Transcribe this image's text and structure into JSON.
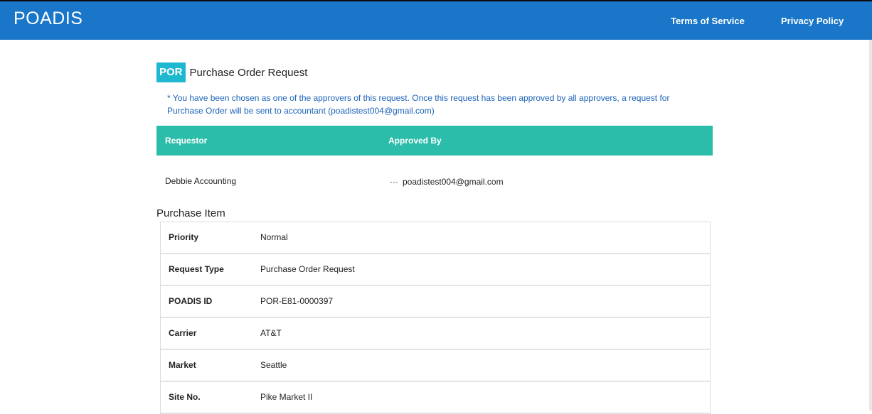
{
  "header": {
    "logo": "POADIS",
    "links": [
      "Terms of Service",
      "Privacy Policy"
    ]
  },
  "page": {
    "badge": "POR",
    "title": "Purchase Order Request",
    "notice": "* You have been chosen as one of the approvers of this request. Once this request has been approved by all approvers, a request for Purchase Order will be sent to accountant (poadistest004@gmail.com)"
  },
  "approvers": {
    "headers": [
      "Requestor",
      "Approved By"
    ],
    "requestor": "Debbie Accounting",
    "approved_by_prefix": "···",
    "approved_by": "poadistest004@gmail.com"
  },
  "purchase_item": {
    "title": "Purchase Item",
    "rows": [
      {
        "label": "Priority",
        "value": "Normal"
      },
      {
        "label": "Request Type",
        "value": "Purchase Order Request"
      },
      {
        "label": "POADIS ID",
        "value": "POR-E81-0000397"
      },
      {
        "label": "Carrier",
        "value": "AT&T"
      },
      {
        "label": "Market",
        "value": "Seattle"
      },
      {
        "label": "Site No.",
        "value": "Pike Market II"
      }
    ]
  }
}
